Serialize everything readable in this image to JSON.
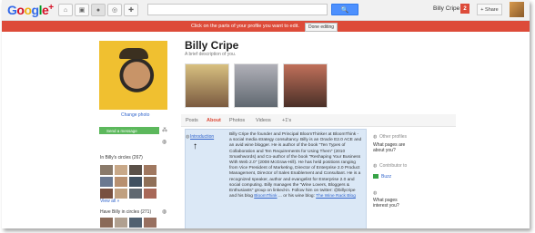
{
  "topbar": {
    "logo_main": "Google",
    "logo_plus": "+",
    "search_button": "🔍",
    "username": "Billy Cripe",
    "notification_count": "2",
    "share_label": "+ Share"
  },
  "banner": {
    "message": "Click on the parts of your profile you want to edit.",
    "done_label": "Done editing",
    "color": "#dd4b39"
  },
  "profile": {
    "name": "Billy Cripe",
    "description": "A brief description of you.",
    "change_photo": "Change photo",
    "send_message": "Send a message"
  },
  "circles": {
    "in_circles": "In Billy's circles (267)",
    "view_all": "View all »",
    "have_circles": "Have Billy in circles (271)"
  },
  "tabs": [
    {
      "label": "Posts"
    },
    {
      "label": "About"
    },
    {
      "label": "Photos"
    },
    {
      "label": "Videos"
    },
    {
      "label": "+1's"
    }
  ],
  "intro": {
    "label": "Introduction",
    "text": "Billy Cripe the founder and Principal BloomThinker at BloomThink - a social media strategy consultancy. Billy is an Oracle E2.0 ACE and an avid wine blogger. He is author of the book \"Ten Types of Collaboration and Ten Requirements for Using Them\" (2010 Smashwords) and Co-author of the book \"Reshaping Your Business With Web 2.0\" (2008 McGraw-Hill). He has held positions ranging from Vice President of Marketing, Director of Enterprise 2.0 Product Management, Director of Sales Enablement and Consultant. He is a recognized speaker, author and evangelist for Enterprise 2.0 and social computing. Billy manages the \"Wine Lovers, Bloggers & Enthusiasts\" group on linked-in. Follow him on twitter: @billycripe and his blog",
    "blog_link": "BloomThink",
    "wine_text": "... or his wine blog:",
    "wine_link": "The Wine Rack Blog"
  },
  "right_sidebar": {
    "other_profiles": "Other profiles",
    "q1": "What pages are about you?",
    "contributor": "Contributor to",
    "buzz": "Buzz",
    "q2": "What pages interest you?"
  }
}
